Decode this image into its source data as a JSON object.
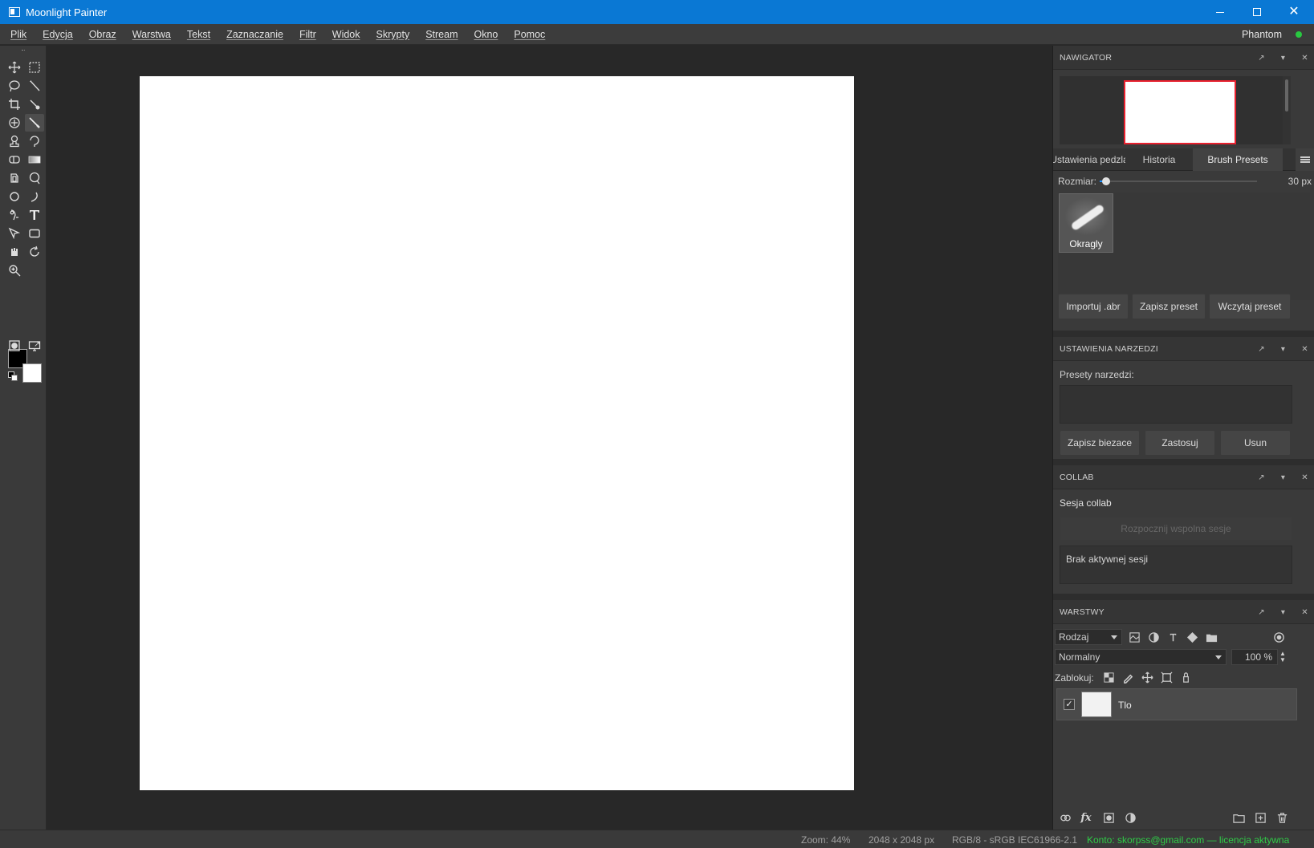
{
  "window": {
    "title": "Moonlight Painter"
  },
  "menu": {
    "items": [
      "Plik",
      "Edycja",
      "Obraz",
      "Warstwa",
      "Tekst",
      "Zaznaczanie",
      "Filtr",
      "Widok",
      "Skrypty",
      "Stream",
      "Okno",
      "Pomoc"
    ],
    "user": "Phantom"
  },
  "panels": {
    "navigator": {
      "title": "NAWIGATOR"
    },
    "brush": {
      "tabs": [
        "Ustawienia pedzla",
        "Historia",
        "Brush Presets"
      ],
      "active_tab": "Brush Presets",
      "size_label": "Rozmiar:",
      "size_value": "30 px",
      "size_fraction": 0.04,
      "preset_name": "Okragly",
      "buttons": [
        "Importuj .abr",
        "Zapisz preset",
        "Wczytaj preset"
      ]
    },
    "tool_settings": {
      "title": "USTAWIENIA NARZEDZI",
      "presets_label": "Presety narzedzi:",
      "buttons": [
        "Zapisz biezace",
        "Zastosuj",
        "Usun"
      ]
    },
    "collab": {
      "title": "COLLAB",
      "session_label": "Sesja collab",
      "start_button": "Rozpocznij wspolna sesje",
      "status": "Brak aktywnej sesji"
    },
    "layers": {
      "title": "WARSTWY",
      "kind_filter": "Rodzaj",
      "blend_mode": "Normalny",
      "opacity": "100 %",
      "lock_label": "Zablokuj:",
      "layers": [
        {
          "name": "Tlo",
          "visible": true
        }
      ]
    }
  },
  "status": {
    "zoom": "Zoom: 44%",
    "size": "2048 x 2048 px",
    "color_mode": "RGB/8 - sRGB IEC61966-2.1",
    "license": "Konto: skorpss@gmail.com — licencja aktywna"
  },
  "colors": {
    "accent": "#0a78d4",
    "foreground_swatch": "#000000",
    "background_swatch": "#ffffff",
    "navigator_frame": "#e8202e",
    "license_text": "#2fcc47",
    "online_dot": "#28c840"
  }
}
